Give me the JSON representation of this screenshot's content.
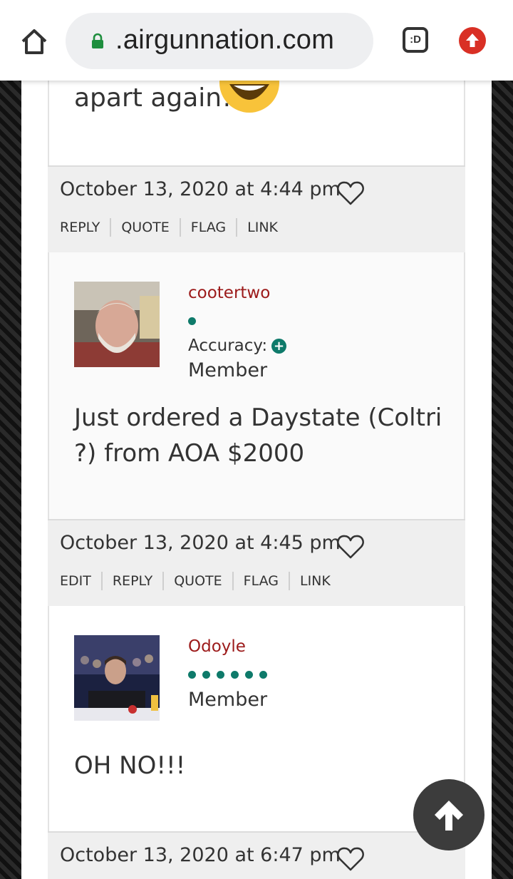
{
  "browser": {
    "url": ".airgunnation.com",
    "tabs_label": ":D",
    "home_icon": "home-icon",
    "lock_icon": "lock-icon",
    "update_icon": "arrow-up-circle-icon",
    "update_color": "#d93025",
    "lock_color": "#1e8e3e"
  },
  "prev_post": {
    "text_tail": "apart again!",
    "emoji": "laughing-emoji-icon"
  },
  "posts": [
    {
      "date": "October 13, 2020 at 4:44 pm",
      "actions": [
        "REPLY",
        "QUOTE",
        "FLAG",
        "LINK"
      ],
      "author": "cootertwo",
      "accuracy_label": "Accuracy:",
      "role": "Member",
      "message": "Just ordered a Daystate (Coltri ?) from AOA $2000"
    },
    {
      "date": "October 13, 2020 at 4:45 pm",
      "actions": [
        "EDIT",
        "REPLY",
        "QUOTE",
        "FLAG",
        "LINK"
      ],
      "author": "Odoyle",
      "role": "Member",
      "message": "OH NO!!!"
    },
    {
      "date": "October 13, 2020 at 6:47 pm"
    }
  ],
  "colors": {
    "username": "#9c1a1a",
    "rank_dot": "#0e7a6a",
    "meta_bg": "#efefef"
  },
  "scroll_top_icon": "arrow-up-icon"
}
